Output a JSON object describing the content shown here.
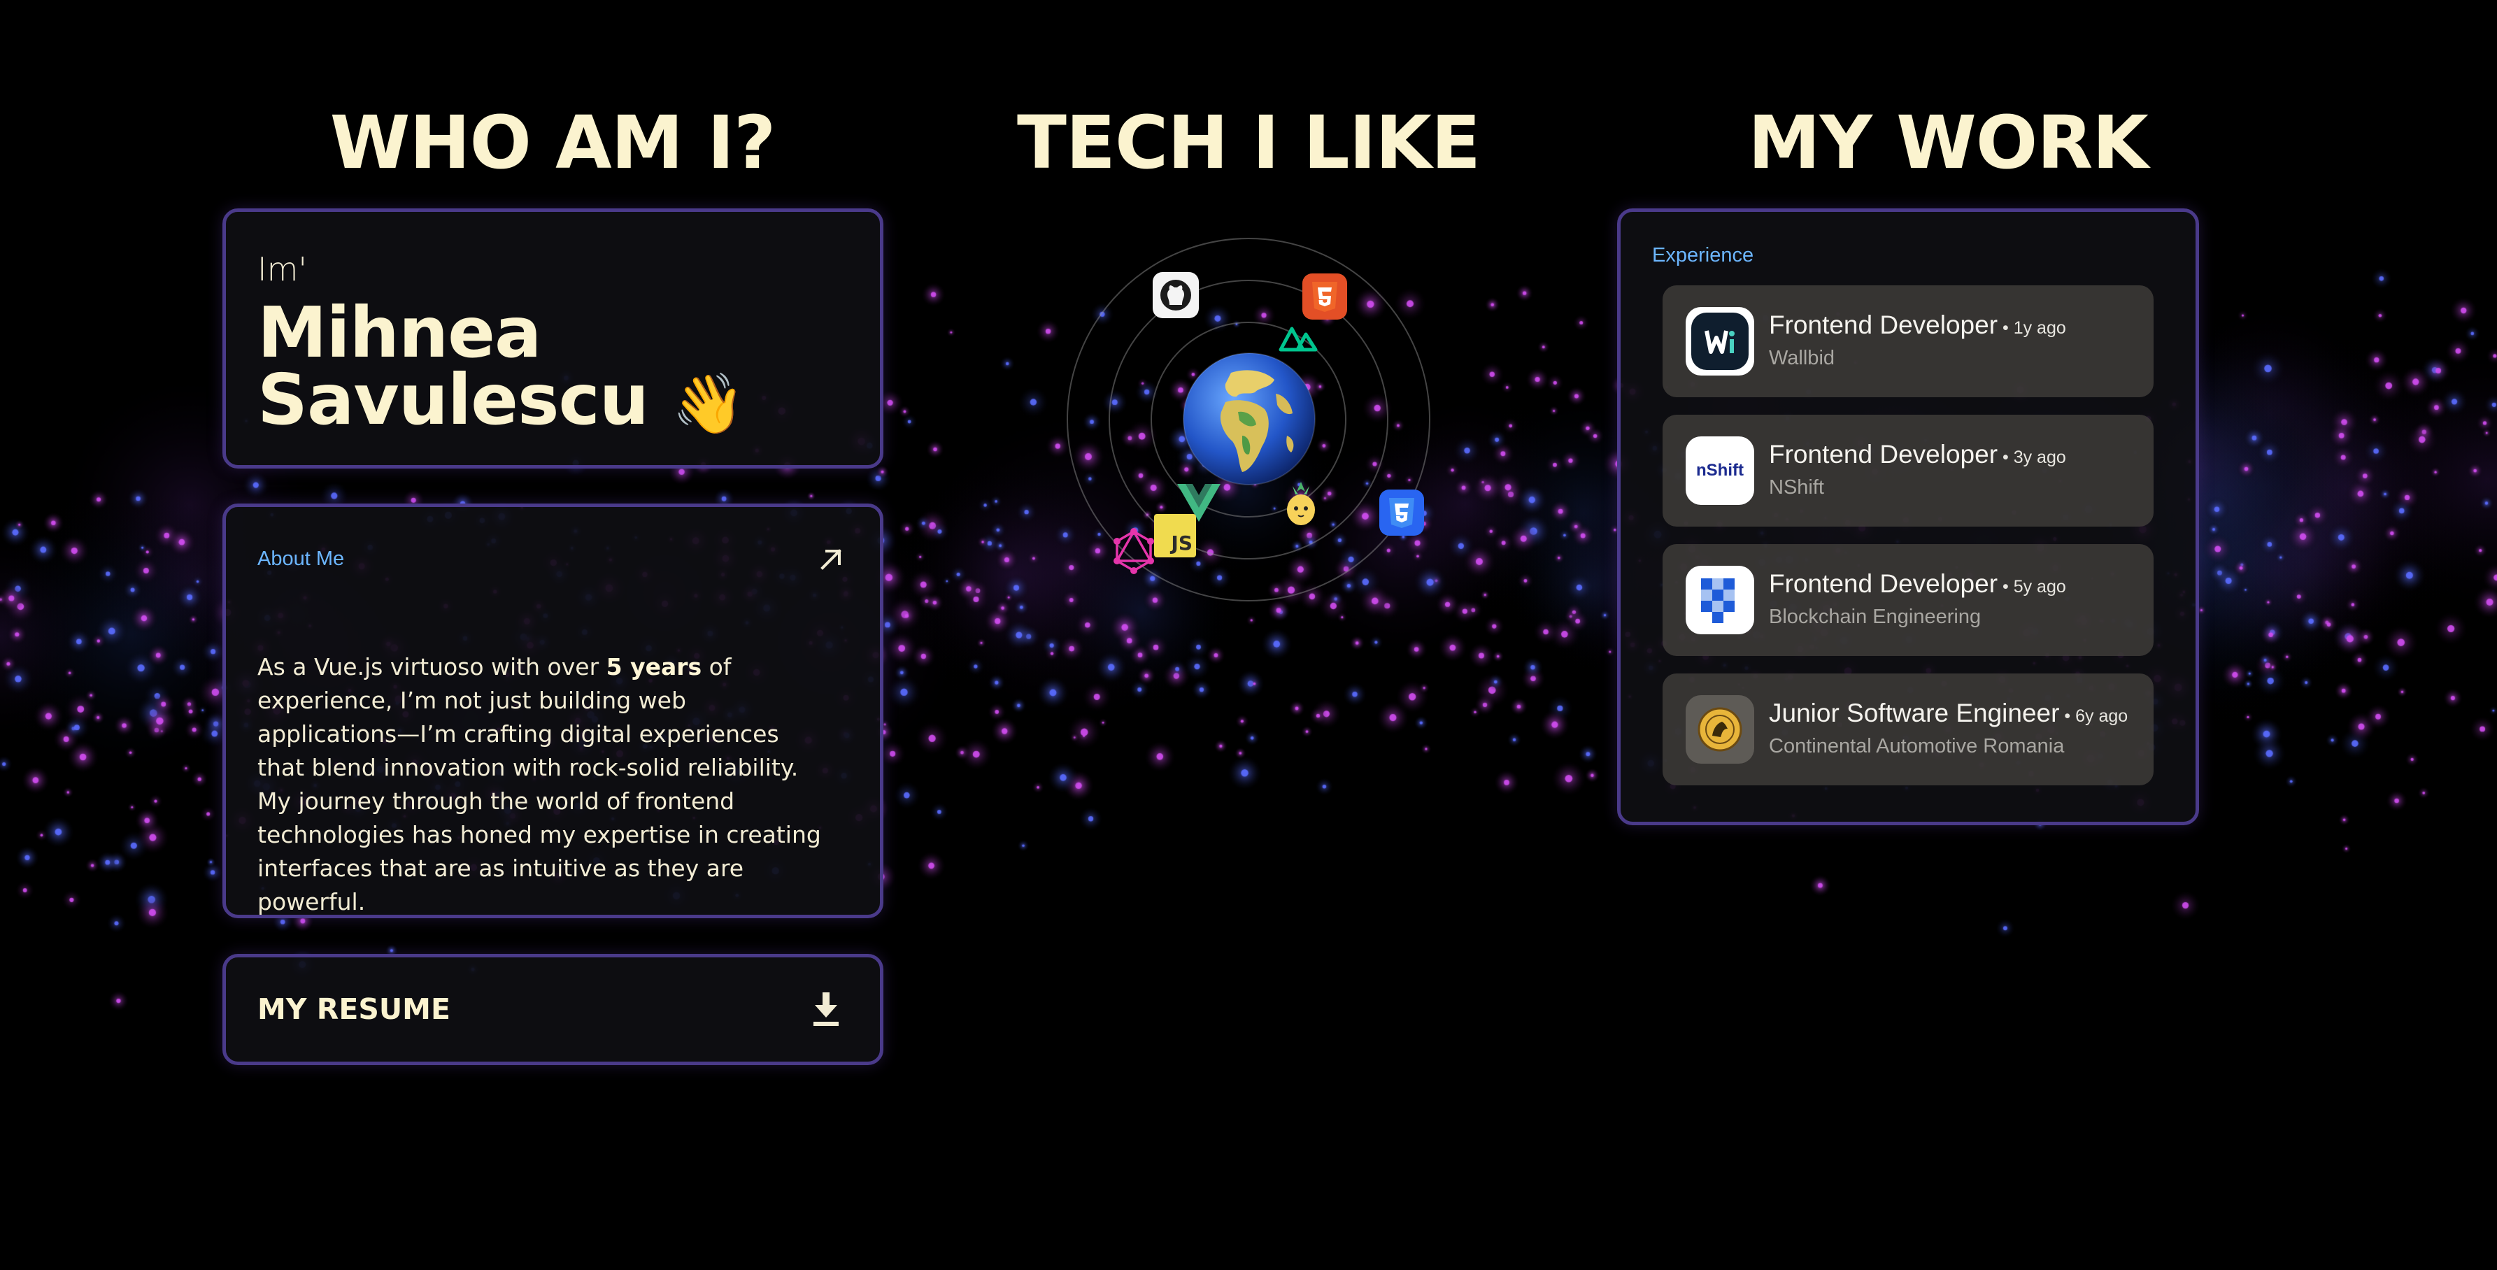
{
  "sections": {
    "who_title": "WHO AM I?",
    "tech_title": "TECH I LIKE",
    "work_title": "MY WORK"
  },
  "intro": {
    "prefix": "Im'",
    "first_name": "Mihnea",
    "last_name": "Savulescu",
    "wave_emoji": "👋"
  },
  "about": {
    "label": "About Me",
    "text_before": "As a Vue.js virtuoso with over ",
    "text_bold": "5 years",
    "text_after": " of experience, I’m not just building web applications—I’m crafting digital experiences that blend innovation with rock-solid reliability. My journey through the world of frontend technologies has honed my expertise in creating interfaces that are as intuitive as they are powerful.",
    "icon": "arrow-up-right-icon"
  },
  "resume": {
    "label": "MY RESUME",
    "icon": "download-icon"
  },
  "tech": {
    "center": "earth-globe",
    "icons": [
      "github-icon",
      "html5-icon",
      "nuxt-icon",
      "vue-icon",
      "pinia-icon",
      "css3-icon",
      "javascript-icon",
      "graphql-icon"
    ],
    "js_label": "JS"
  },
  "work": {
    "label": "Experience",
    "jobs": [
      {
        "title": "Frontend Developer",
        "ago": "1y ago",
        "company": "Wallbid",
        "logo": "wallbid-logo"
      },
      {
        "title": "Frontend Developer",
        "ago": "3y ago",
        "company": "NShift",
        "logo": "nshift-logo",
        "logo_text": "nShift"
      },
      {
        "title": "Frontend Developer",
        "ago": "5y ago",
        "company": "Blockchain Engineering",
        "logo": "blockchain-engineering-logo"
      },
      {
        "title": "Junior Software Engineer",
        "ago": "6y ago",
        "company": "Continental Automotive Romania",
        "logo": "continental-logo"
      }
    ],
    "separator": " • "
  },
  "colors": {
    "title": "#fbf3cf",
    "card_border": "#4a3a8a",
    "label_blue": "#6cb6ff",
    "star_pink": "#d04cf0",
    "star_blue": "#5a6cff"
  }
}
